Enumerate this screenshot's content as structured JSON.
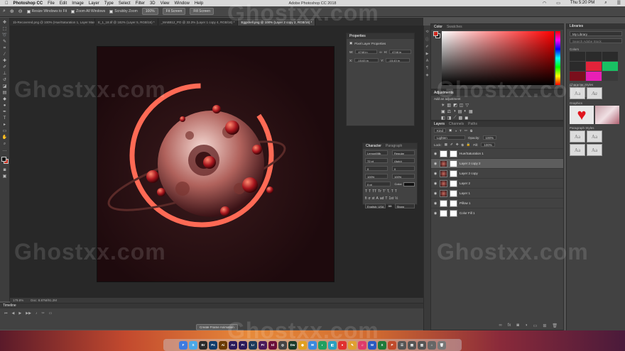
{
  "menubar": {
    "app": "Photoshop CC",
    "items": [
      "File",
      "Edit",
      "Image",
      "Layer",
      "Type",
      "Select",
      "Filter",
      "3D",
      "View",
      "Window",
      "Help"
    ],
    "window_title": "Adobe Photoshop CC 2018",
    "clock": "Thu 5:20 PM"
  },
  "options": {
    "resize_windows": "Resize Windows to Fit",
    "zoom_all": "Zoom All Windows",
    "scrubby": "Scrubby Zoom",
    "zoom_pct": "100%",
    "fit_screen": "Fit Screen",
    "fill_screen": "Fill Screen"
  },
  "tabs": [
    "1b-Recovered.png @ 100% (Hue/Saturation 1, Layer Mask/16) *",
    "E_1_18.tif @ 182% (Layer 5, RGB/16) *",
    "_MAB812_PO @ 33.3% (Layer 1 copy 4, RGB/16) *",
    "Eggshell.png @ 100% (Layer 2 copy 2, RGB/16) *"
  ],
  "status": {
    "zoom": "179.8%",
    "doc": "Doc: 8.87M/91.2M"
  },
  "timeline": {
    "title": "Timeline",
    "create_button": "Create Frame Animation"
  },
  "properties": {
    "tab": "Properties",
    "subtitle": "Pixel Layer Properties",
    "w_label": "W:",
    "w": "4748 in",
    "h_label": "H:",
    "h": "4748 in",
    "x_label": "X:",
    "x": "-15.63 in",
    "y_label": "Y:",
    "y": "-15.43 in"
  },
  "character": {
    "tabs": [
      "Character",
      "Paragraph"
    ],
    "font": "LemonMilk",
    "style": "Regular",
    "size": "72 pt",
    "leading": "(Auto)",
    "kerning": "0",
    "tracking": "0",
    "scale_v": "100%",
    "scale_h": "100%",
    "baseline": "0 pt",
    "color_label": "Color:",
    "styles": [
      "T",
      "T",
      "TT",
      "Tr",
      "T'",
      "T,",
      "T",
      "T"
    ],
    "opentype": [
      "fi",
      "σ",
      "st",
      "A",
      "ad",
      "T",
      "1st",
      "½"
    ],
    "language": "English: USA",
    "aa": "aa",
    "sharp": "Sharp"
  },
  "color_panel": {
    "tabs": [
      "Color",
      "Swatches"
    ]
  },
  "adjustments": {
    "tabs": [
      "Adjustments"
    ],
    "add_label": "Add an adjustment",
    "row1": [
      "☀",
      "▥",
      "◩",
      "◫",
      "▽"
    ],
    "row2": [
      "▣",
      "⚖",
      "◑",
      "▤",
      "◐",
      "▦"
    ],
    "row3": [
      "◧",
      "◨",
      "⟋",
      "▩",
      "◼"
    ]
  },
  "layers": {
    "tabs": [
      "Layers",
      "Channels",
      "Paths"
    ],
    "kind": "Kind",
    "blend": "Lighten",
    "opacity_label": "Opacity:",
    "opacity": "100%",
    "lock_label": "Lock:",
    "fill_label": "Fill:",
    "fill": "100%",
    "rows": [
      {
        "name": "Hue/Saturation 1",
        "thumb": "w",
        "selected": false
      },
      {
        "name": "Layer 2 copy 2",
        "thumb": "pl",
        "selected": true
      },
      {
        "name": "Layer 2 copy",
        "thumb": "pl",
        "selected": false
      },
      {
        "name": "Layer 2",
        "thumb": "pl",
        "selected": false
      },
      {
        "name": "Layer 1",
        "thumb": "pl",
        "selected": false
      },
      {
        "name": "Pillow 1",
        "thumb": "w",
        "selected": false
      },
      {
        "name": "Color Fill 1",
        "thumb": "w",
        "selected": false
      }
    ]
  },
  "libraries": {
    "tab": "Libraries",
    "library": "My Library",
    "search_placeholder": "Search Adobe Stock",
    "colors_label": "Colors",
    "swatches": [
      "#2b2b2b",
      "#2b2b2b",
      "#2b2b2b",
      "#2b2b2b",
      "#e2233a",
      "#19c163",
      "#7a0f1c",
      "#e81fb5",
      "#3a3a3a"
    ],
    "char_styles_label": "Character Styles",
    "graphics_label": "Graphics",
    "para_styles_label": "Paragraph Styles",
    "style_sample": "Aa"
  },
  "watermark": "Ghostxx.com",
  "dock": [
    {
      "t": "F",
      "c": "#3d7be0"
    },
    {
      "t": "S",
      "c": "#4aa8e8"
    },
    {
      "t": "Br",
      "c": "#2a2a2a"
    },
    {
      "t": "Ps",
      "c": "#0f3c6b"
    },
    {
      "t": "Ai",
      "c": "#6b3a00"
    },
    {
      "t": "Ae",
      "c": "#2b1a5a"
    },
    {
      "t": "Pr",
      "c": "#2b1a5a"
    },
    {
      "t": "Lr",
      "c": "#1c3a5a"
    },
    {
      "t": "Pr",
      "c": "#4a1a5a"
    },
    {
      "t": "Id",
      "c": "#6b0f3a"
    },
    {
      "t": "◎",
      "c": "#444"
    },
    {
      "t": "Dw",
      "c": "#1a3a2a"
    },
    {
      "t": "◉",
      "c": "#e0a020"
    },
    {
      "t": "✉",
      "c": "#3a8ae0"
    },
    {
      "t": "◐",
      "c": "#20a060"
    },
    {
      "t": "◧",
      "c": "#2aa0c0"
    },
    {
      "t": "●",
      "c": "#e03030"
    },
    {
      "t": "✎",
      "c": "#e0a030"
    },
    {
      "t": "♫",
      "c": "#e03a6a"
    },
    {
      "t": "W",
      "c": "#2a5ac0"
    },
    {
      "t": "X",
      "c": "#1f7a3a"
    },
    {
      "t": "P",
      "c": "#c04a2a"
    },
    {
      "t": "☰",
      "c": "#555"
    },
    {
      "t": "▤",
      "c": "#555"
    },
    {
      "t": "▥",
      "c": "#555"
    },
    {
      "t": "⌂",
      "c": "#666"
    },
    {
      "t": "🗑",
      "c": "#777"
    }
  ]
}
